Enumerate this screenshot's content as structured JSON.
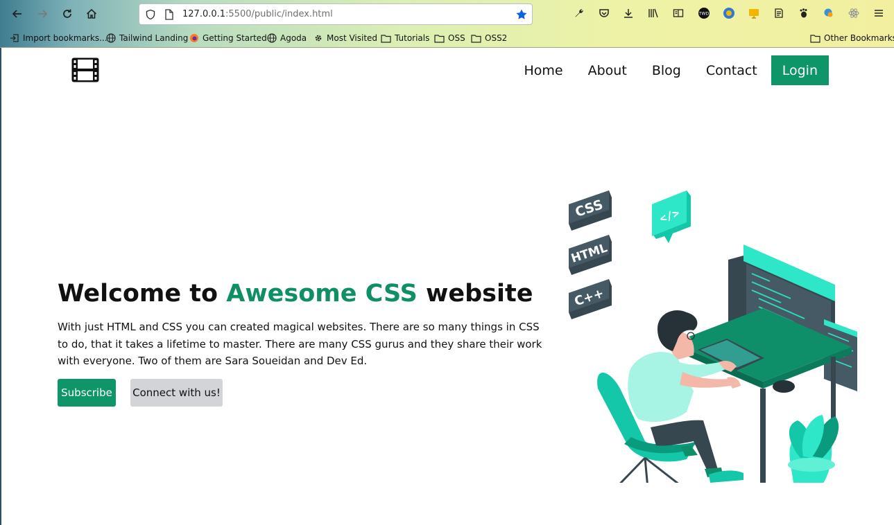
{
  "browser": {
    "url_host": "127.0.0.1",
    "url_path": ":5500/public/index.html",
    "bookmarks": [
      {
        "label": "Import bookmarks...",
        "icon": "import-icon"
      },
      {
        "label": "Tailwind Landing",
        "icon": "globe-icon"
      },
      {
        "label": "Getting Started",
        "icon": "firefox-icon"
      },
      {
        "label": "Agoda",
        "icon": "globe-icon"
      },
      {
        "label": "Most Visited",
        "icon": "gear-icon"
      },
      {
        "label": "Tutorials",
        "icon": "folder-icon"
      },
      {
        "label": "OSS",
        "icon": "folder-icon"
      },
      {
        "label": "OSS2",
        "icon": "folder-icon"
      }
    ],
    "other_bookmarks": "Other Bookmarks"
  },
  "nav": {
    "items": [
      "Home",
      "About",
      "Blog",
      "Contact"
    ],
    "login": "Login"
  },
  "hero": {
    "title_prefix": "Welcome to ",
    "title_accent": "Awesome CSS",
    "title_suffix": " website",
    "description": "With just HTML and CSS you can created magical websites. There are so many things in CSS to do, that it takes a lifetime to master. There are many CSS gurus and they share their work with everyone. Two of them are Sara Soueidan and Dev Ed.",
    "subscribe": "Subscribe",
    "connect": "Connect with us!"
  },
  "illustration": {
    "badges": [
      "CSS",
      "HTML",
      "C++"
    ],
    "code_tag": "</>"
  },
  "colors": {
    "accent": "#0e9669",
    "accent_text": "#0e8f64",
    "teal_light": "#2ee6c8",
    "dark_slate": "#37474f"
  }
}
